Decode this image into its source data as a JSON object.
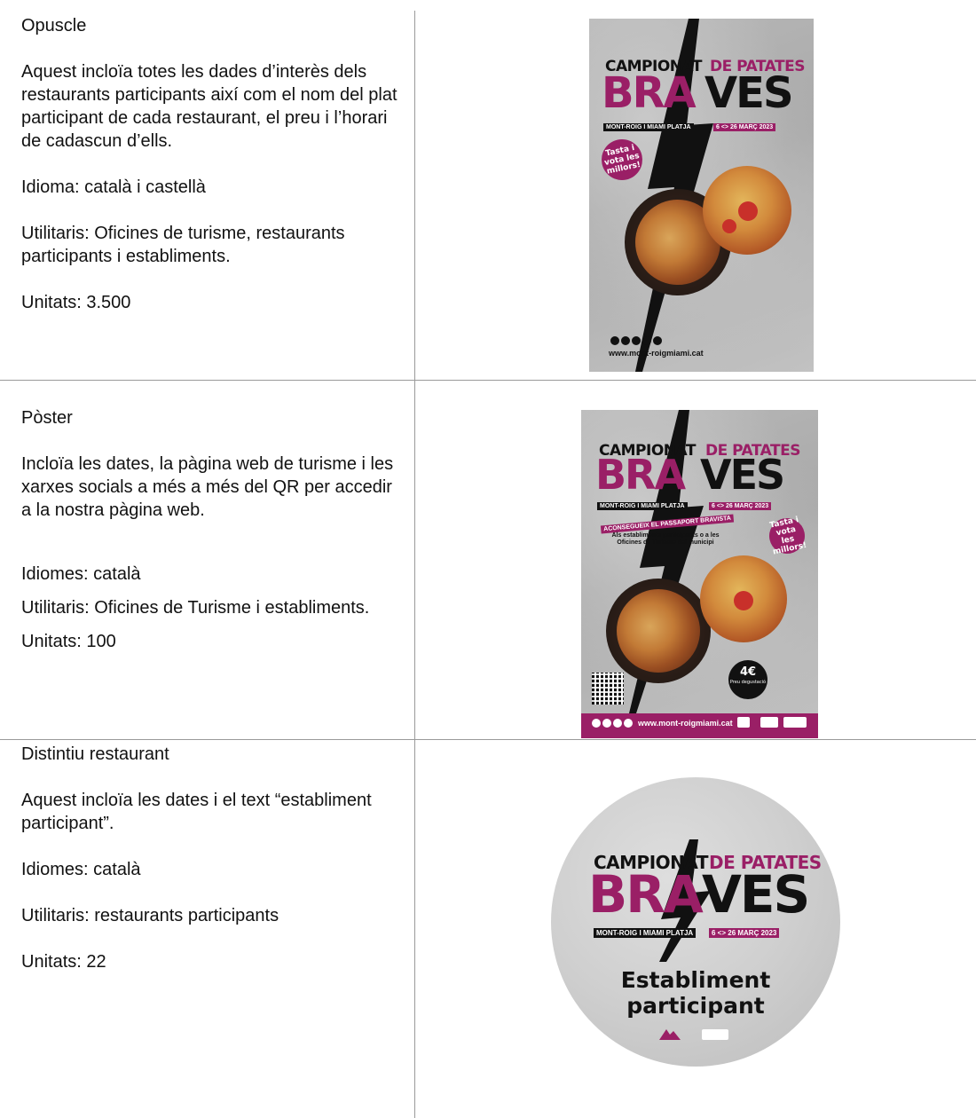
{
  "rows": [
    {
      "heading": "Opuscle",
      "description": "Aquest incloïa totes les dades d’interès dels restaurants participants així com el nom del plat participant de cada restaurant, el preu i l’horari de cadascun d’ells.",
      "language": "Idioma: català i castellà",
      "users": "Utilitaris: Oficines de turisme, restaurants participants i establiments.",
      "units": "Unitats: 3.500"
    },
    {
      "heading": "Pòster",
      "description": "Incloïa les dates, la pàgina web de turisme i les xarxes socials a més a més del QR per accedir a la nostra pàgina web.",
      "language": "Idiomes: català",
      "users": "Utilitaris: Oficines de Turisme i establiments.",
      "units": "Unitats: 100"
    },
    {
      "heading": "Distintiu restaurant",
      "description": "Aquest incloïa les dates i el text “establiment participant”.",
      "language": "Idiomes: català",
      "users": "Utilitaris: restaurants participants",
      "units": "Unitats: 22"
    }
  ],
  "poster": {
    "title_line1_left": "CAMPIONAT",
    "title_line1_right": "DE PATATES",
    "title_big_left": "BRA",
    "title_big_right": "VES",
    "location": "MONT-ROIG I MIAMI PLATJA",
    "dates": "6 <> 26 MARÇ 2023",
    "badge": "Tasta i vota les millors!",
    "website": "www.mont-roigmiami.cat",
    "passport_title": "ACONSEGUEIX EL PASSAPORT BRAVISTA",
    "passport_text": "Als establiments participants o a les Oficines de Turisme del municipi",
    "price": "4€",
    "price_label": "Preu degustació",
    "sticker_text_line1": "Establiment",
    "sticker_text_line2": "participant"
  },
  "colors": {
    "brand_magenta": "#9a1f66",
    "text": "#111111",
    "grid": "#9a9a9a"
  }
}
